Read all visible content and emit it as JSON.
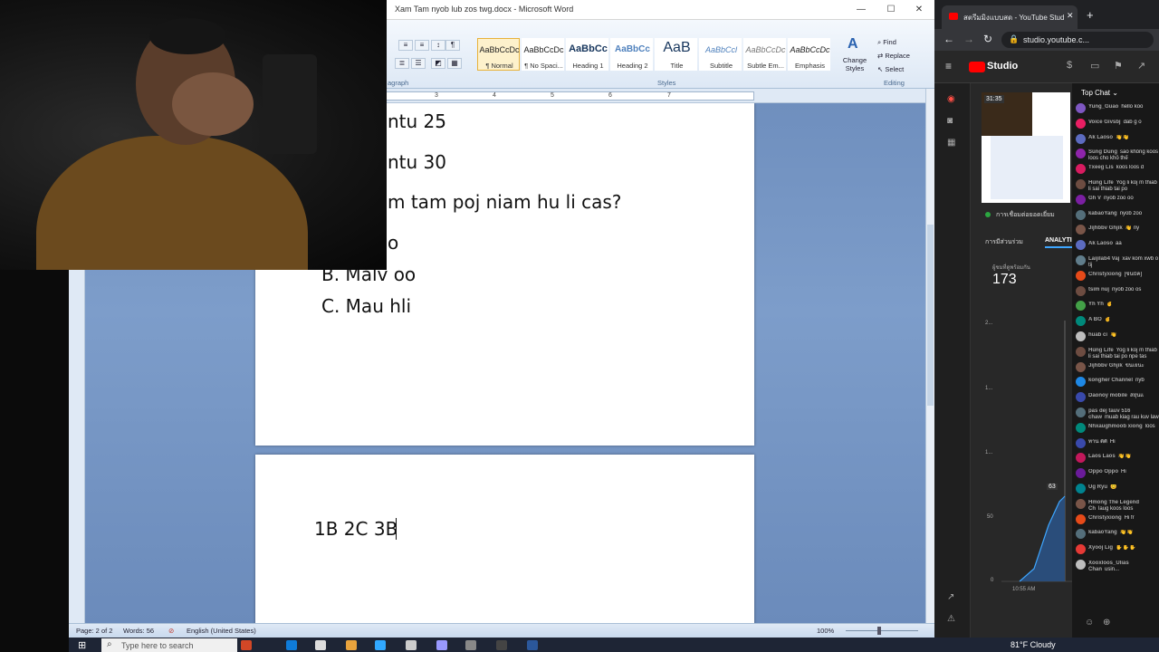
{
  "word": {
    "title": "Xam Tam nyob lub zos twg.docx - Microsoft Word",
    "controls": {
      "minimize": "—",
      "maximize": "☐",
      "close": "✕"
    },
    "styles": [
      {
        "sample": "AaBbCcDc",
        "name": "¶ Normal",
        "active": true
      },
      {
        "sample": "AaBbCcDc",
        "name": "¶ No Spaci..."
      },
      {
        "sample": "AaBbCc",
        "name": "Heading 1"
      },
      {
        "sample": "AaBbCc",
        "name": "Heading 2"
      },
      {
        "sample": "AaB",
        "name": "Title"
      },
      {
        "sample": "AaBbCcl",
        "name": "Subtitle"
      },
      {
        "sample": "AaBbCcDc",
        "name": "Subtle Em..."
      },
      {
        "sample": "AaBbCcDc",
        "name": "Emphasis"
      }
    ],
    "change_styles": "Change Styles",
    "editing": {
      "find": "Find",
      "replace": "Replace",
      "select": "Select"
    },
    "group_labels": {
      "paragraph": "agraph",
      "styles": "Styles",
      "editing": "Editing"
    },
    "ruler_numbers": [
      "1",
      "2",
      "3",
      "4",
      "5",
      "6",
      "7"
    ],
    "page1_lines": [
      "ntu 25",
      "ntu 30",
      "m tam poj niam hu li cas?",
      "o",
      "B. Malv oo",
      "C. Mau hli"
    ],
    "page2_lines": [
      "1B 2C 3B"
    ],
    "status": {
      "page": "Page: 2 of 2",
      "words": "Words: 56",
      "language": "English (United States)",
      "zoom": "100%"
    }
  },
  "browser": {
    "tab_title": "สตรีมมิงแบบสด - YouTube Studio",
    "url": "studio.youtube.c...",
    "yt_brand": "Studio"
  },
  "studio": {
    "live_time": "31:35",
    "status_text": "การเชื่อมต่อยอดเยี่ยม",
    "tabs": [
      "การมีส่วนร่วม",
      "ANALYTICS"
    ],
    "concurrent_label": "ผู้ชมที่ดูพร้อมกัน",
    "concurrent_value": "173",
    "chart_y_labels": [
      "2...",
      "1...",
      "1...",
      "50",
      "0"
    ],
    "chart_x_label": "10:55 AM",
    "chart_badge": "63"
  },
  "chat": {
    "header": "Top Chat",
    "messages": [
      {
        "author": "Yung_Guao",
        "text": "hello koo",
        "color": "#7e57c2"
      },
      {
        "author": "Voice Givsbj",
        "text": "dab g o",
        "color": "#e91e63"
      },
      {
        "author": "Ak Laoso",
        "text": "👋👋",
        "color": "#5c6bc0"
      },
      {
        "author": "Sùng Dung",
        "text": "sao không koos loos cho khỏ thế",
        "color": "#8e24aa"
      },
      {
        "author": "Txeeg Lis",
        "text": "koos loos d",
        "color": "#d81b60"
      },
      {
        "author": "Hùng Life",
        "text": "Yog li koj m thiab li sai thiab tai po",
        "color": "#6d4c41"
      },
      {
        "author": "Gh V",
        "text": "nyob zoo oo",
        "color": "#7b1fa2"
      },
      {
        "author": "kabaoYang",
        "text": "nyob zoo",
        "color": "#546e7a"
      },
      {
        "author": "Jijhbbv Ghjik",
        "text": "👋 ny",
        "color": "#795548"
      },
      {
        "author": "Ak Laoso",
        "text": "aa",
        "color": "#5c6bc0"
      },
      {
        "author": "Laijilab4 Vaj",
        "text": "xav kom xwb o tij",
        "color": "#607d8b"
      },
      {
        "author": "Christyxiong",
        "text": "[ขึ้นบัค]",
        "color": "#e64a19"
      },
      {
        "author": "tsim nuj",
        "text": "nyob zoo os",
        "color": "#6d4c41"
      },
      {
        "author": "Yh Yh",
        "text": "✌",
        "color": "#43a047"
      },
      {
        "author": "A BO",
        "text": "✌",
        "color": "#00897b"
      },
      {
        "author": "huab ci",
        "text": "👋",
        "color": "#bdbdbd"
      },
      {
        "author": "Hùng Life",
        "text": "Yog li koj m thiab li sai thiab tai po npe tas",
        "color": "#6d4c41"
      },
      {
        "author": "Jijhbbv Ghjik",
        "text": "ขึ้นเยนะ",
        "color": "#795548"
      },
      {
        "author": "kongher Channel",
        "text": "nyb",
        "color": "#1e88e5"
      },
      {
        "author": "Daonoy mobile",
        "text": "สยุ่นแ",
        "color": "#3949ab"
      },
      {
        "author": "pas dej tauv 516 chaw",
        "text": "muab kiag rau kuv law",
        "color": "#546e7a"
      },
      {
        "author": "Nhxaughmoob xiong",
        "text": "loos",
        "color": "#00897b"
      },
      {
        "author": "ทาน ตีดี",
        "text": "Hi",
        "color": "#3949ab"
      },
      {
        "author": "Laos Laos",
        "text": "👋👋",
        "color": "#c2185b"
      },
      {
        "author": "Oppo Oppo",
        "text": "Hi",
        "color": "#6a1b9a"
      },
      {
        "author": "Ug Ryu",
        "text": "😊",
        "color": "#00838f"
      },
      {
        "author": "Hmong The Legend Ch",
        "text": "laug koos loos",
        "color": "#795548"
      },
      {
        "author": "Christyxiong",
        "text": "Hi fr",
        "color": "#e64a19"
      },
      {
        "author": "kabaoYang",
        "text": "👋👋",
        "color": "#546e7a"
      },
      {
        "author": "Xyooj Lig",
        "text": "✋✋✋",
        "color": "#e53935"
      },
      {
        "author": "Xooxloos_Ulias Chan",
        "text": "usin...",
        "color": "#bdbdbd"
      }
    ]
  },
  "taskbar": {
    "search_placeholder": "Type here to search",
    "weather": "81°F  Cloudy"
  }
}
